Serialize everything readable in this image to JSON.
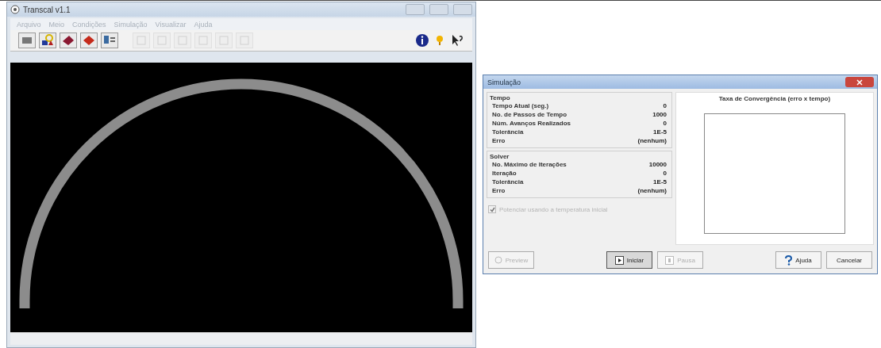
{
  "main_window": {
    "title": "Transcal v1.1",
    "menu": [
      {
        "label": "Arquivo"
      },
      {
        "label": "Meio"
      },
      {
        "label": "Condições"
      },
      {
        "label": "Simulação"
      },
      {
        "label": "Visualizar"
      },
      {
        "label": "Ajuda"
      }
    ],
    "toolbar": [
      {
        "disabled": false
      },
      {
        "disabled": false
      },
      {
        "disabled": false
      },
      {
        "disabled": false
      },
      {
        "disabled": false
      },
      {
        "disabled": true
      },
      {
        "disabled": true
      },
      {
        "disabled": true
      },
      {
        "disabled": true
      },
      {
        "disabled": true
      },
      {
        "disabled": true
      }
    ]
  },
  "dialog": {
    "title": "Simulação",
    "groups": [
      {
        "title": "Tempo",
        "rows": [
          {
            "label": "Tempo Atual (seg.)",
            "value": "0"
          },
          {
            "label": "No. de Passos de Tempo",
            "value": "1000"
          },
          {
            "label": "Núm. Avanços Realizados",
            "value": "0"
          },
          {
            "label": "Tolerância",
            "value": "1E-5"
          },
          {
            "label": "Erro",
            "value": "(nenhum)"
          }
        ]
      },
      {
        "title": "Solver",
        "rows": [
          {
            "label": "No. Máximo de Iterações",
            "value": "10000"
          },
          {
            "label": "Iteração",
            "value": "0"
          },
          {
            "label": "Tolerância",
            "value": "1E-5"
          },
          {
            "label": "Erro",
            "value": "(nenhum)"
          }
        ]
      }
    ],
    "checkbox": {
      "label": "Potenciar usando a temperatura inicial",
      "checked": true,
      "disabled": true
    },
    "chart_title": "Taxa de Convergência (erro x tempo)",
    "buttons": [
      {
        "label": "Preview",
        "kind": "preview",
        "disabled": true,
        "default": false
      },
      {
        "label": "Iniciar",
        "kind": "start",
        "disabled": false,
        "default": true
      },
      {
        "label": "Pausa",
        "kind": "pause",
        "disabled": true,
        "default": false
      },
      {
        "label": "Ajuda",
        "kind": "help",
        "disabled": false,
        "default": false
      },
      {
        "label": "Cancelar",
        "kind": "cancel",
        "disabled": false,
        "default": false
      }
    ]
  }
}
